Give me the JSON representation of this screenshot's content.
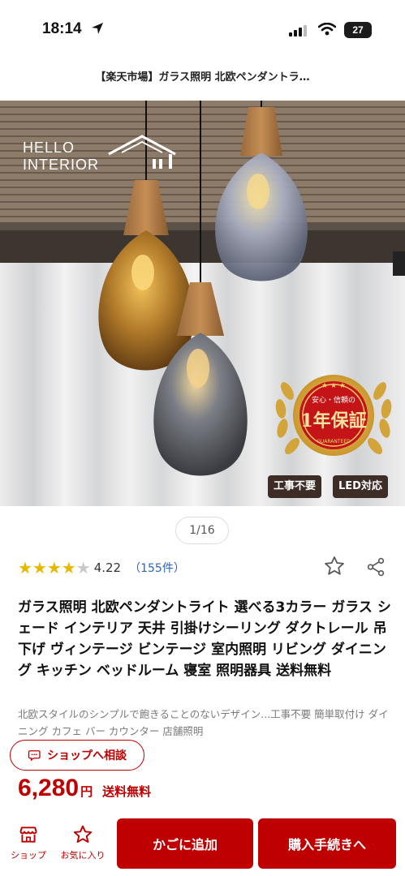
{
  "status_bar": {
    "time": "18:14",
    "battery": "27"
  },
  "page": {
    "title": "【楽天市場】ガラス照明 北欧ペンダントラ…"
  },
  "hero": {
    "logo_line1": "HELLO",
    "logo_line2": "INTERIOR",
    "badge_no_work": "工事不要",
    "badge_led": "LED対応",
    "seal_top": "安心・信頼の",
    "seal_main": "1年保証",
    "seal_bottom": "GUARANTEED"
  },
  "pager": {
    "label": "1/16"
  },
  "rating": {
    "value": "4.22",
    "count": "（155件）",
    "stars_filled": 4,
    "stars_total": 5
  },
  "product": {
    "title": "ガラス照明 北欧ペンダントライト 選べる3カラー ガラス シェード インテリア 天井 引掛けシーリング ダクトレール 吊下げ ヴィンテージ ビンテージ 室内照明 リビング ダイニング キッチン ベッドルーム 寝室 照明器具 送料無料",
    "description": "北欧スタイルのシンプルで飽きることのないデザイン...工事不要 簡単取付け ダイニング カフェ バー カウンター 店舗照明"
  },
  "consult": {
    "label": "ショップへ相談"
  },
  "price": {
    "amount": "6,280",
    "unit": "円",
    "shipping": "送料無料"
  },
  "bottom_bar": {
    "shop_label": "ショップ",
    "favorite_label": "お気に入り",
    "cart_label": "かごに追加",
    "buy_label": "購入手続きへ"
  },
  "colors": {
    "accent": "#bf0000",
    "star": "#e6b800",
    "link": "#2a67b8"
  }
}
